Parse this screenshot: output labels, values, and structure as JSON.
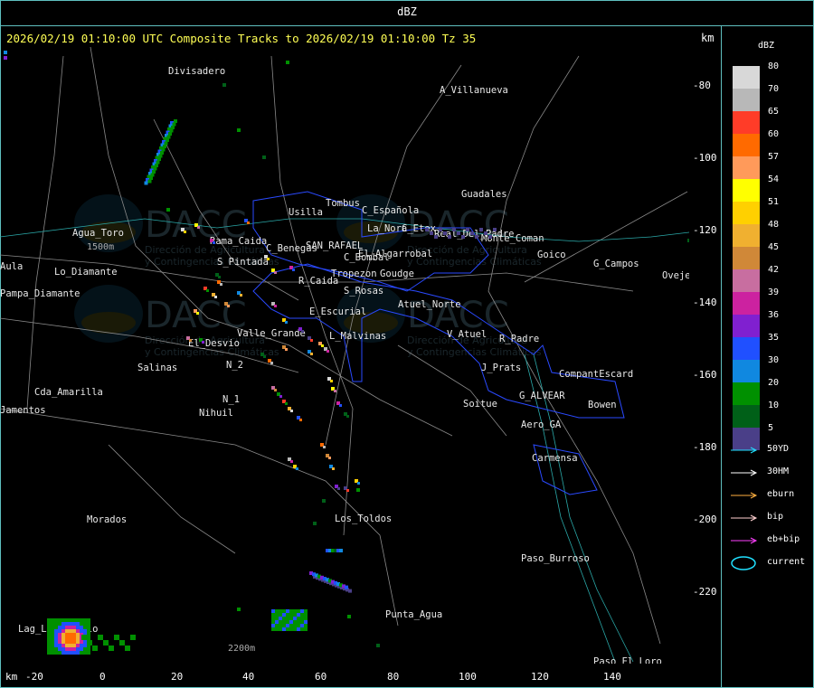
{
  "header": {
    "unit": "dBZ"
  },
  "map": {
    "title": "2026/02/19 01:10:00 UTC Composite Tracks to 2026/02/19 01:10:00 Tz 35",
    "unit_right": "km",
    "unit_bottom": "km",
    "x_ticks": [
      "-20",
      "0",
      "20",
      "40",
      "60",
      "80",
      "100",
      "120",
      "140"
    ],
    "y_ticks": [
      "-80",
      "-100",
      "-120",
      "-140",
      "-160",
      "-180",
      "-200",
      "-220"
    ],
    "place_labels": [
      "Divisadero",
      "A_Villanueva",
      "Guadales",
      "Usilla",
      "Tombus",
      "C_Española",
      "La_Nora",
      "C_Etex",
      "Agua_Toro",
      "Rama_Caida",
      "S_Pintada",
      "C_Benegas",
      "SAN_RAFAEL",
      "El_Algarrobal",
      "C_Bombal",
      "Tropezon",
      "Goudge",
      "Real_Del_Padre",
      "Goico",
      "G_Campos",
      "Ovejero",
      "Pampa_Diamante",
      "Aula",
      "Lo_Diamante",
      "R_Caida",
      "S_Rosas",
      "E_Escurial",
      "Atuel_Norte",
      "Valle_Grande",
      "L_Malvinas",
      "V_Atuel",
      "R_Padre",
      "El_Desvio",
      "Salinas",
      "N_2",
      "J_Prats",
      "CompantEscard",
      "Cda_Amarilla",
      "Jamentos",
      "N_1",
      "Nihuil",
      "G_ALVEAR",
      "Soitue",
      "Bowen",
      "Aero_GA",
      "Carmensa",
      "Los_Toldos",
      "Morados",
      "Paso_Burroso",
      "Punta_Agua",
      "Lag_Llancanelo",
      "Paso_El_Loro",
      "Monte_Coman"
    ],
    "elev_labels": [
      "1500m",
      "2200m"
    ],
    "watermark": {
      "lines": [
        "DACC",
        "Dirección de Agricultura",
        "y Contingencias Climáticas"
      ]
    }
  },
  "legend": {
    "title": "dBZ",
    "levels": [
      {
        "value": "80",
        "color": "#d8d8d8"
      },
      {
        "value": "70",
        "color": "#b8b8b8"
      },
      {
        "value": "65",
        "color": "#ff3c28"
      },
      {
        "value": "60",
        "color": "#ff6a00"
      },
      {
        "value": "57",
        "color": "#ff9a5a"
      },
      {
        "value": "54",
        "color": "#ffff00"
      },
      {
        "value": "51",
        "color": "#ffd000"
      },
      {
        "value": "48",
        "color": "#f0b030"
      },
      {
        "value": "45",
        "color": "#d08838"
      },
      {
        "value": "42",
        "color": "#c86ea0"
      },
      {
        "value": "39",
        "color": "#cc22a0"
      },
      {
        "value": "36",
        "color": "#8020d0"
      },
      {
        "value": "35",
        "color": "#2050ff"
      },
      {
        "value": "30",
        "color": "#1088e0"
      },
      {
        "value": "20",
        "color": "#009000"
      },
      {
        "value": "10",
        "color": "#006018"
      },
      {
        "value": "5",
        "color": "#4a3f88"
      }
    ],
    "tracks": [
      {
        "label": "50YD",
        "color": "#20e0ff"
      },
      {
        "label": "30HM",
        "color": "#ffffff"
      },
      {
        "label": "eburn",
        "color": "#ffb040"
      },
      {
        "label": "bip",
        "color": "#ffd0d0"
      },
      {
        "label": "eb+bip",
        "color": "#ff40ff"
      }
    ],
    "current": {
      "label": "current",
      "color": "#20e0ff"
    }
  }
}
